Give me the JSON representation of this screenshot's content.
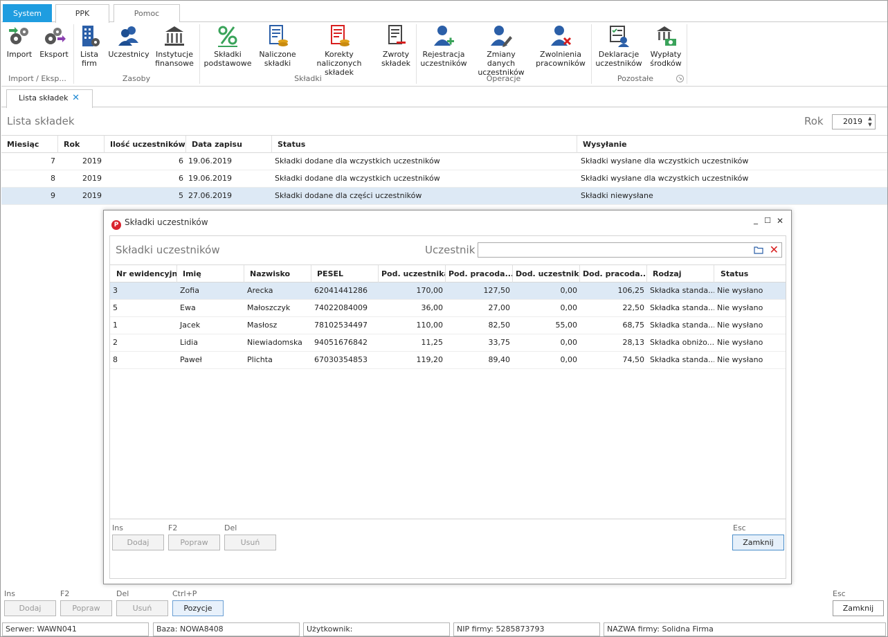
{
  "tabs": {
    "system": "System",
    "ppk": "PPK",
    "pomoc": "Pomoc"
  },
  "ribbon": {
    "buttons": [
      {
        "label": "Import",
        "icon": "gears-import-icon"
      },
      {
        "label": "Eksport",
        "icon": "gears-export-icon"
      },
      {
        "label": "Lista\nfirm",
        "icon": "building-icon"
      },
      {
        "label": "Uczestnicy",
        "icon": "users-icon"
      },
      {
        "label": "Instytucje\nfinansowe",
        "icon": "bank-icon"
      },
      {
        "label": "Składki\npodstawowe",
        "icon": "percent-icon"
      },
      {
        "label": "Naliczone\nskładki",
        "icon": "document-coins-icon"
      },
      {
        "label": "Korekty naliczonych\nskładek",
        "icon": "document-correction-icon"
      },
      {
        "label": "Zwroty\nskładek",
        "icon": "document-return-icon"
      },
      {
        "label": "Rejestracja\nuczestników",
        "icon": "user-add-icon"
      },
      {
        "label": "Zmiany danych\nuczestników",
        "icon": "user-edit-icon"
      },
      {
        "label": "Zwolnienia\npracowników",
        "icon": "user-remove-icon"
      },
      {
        "label": "Deklaracje\nuczestników",
        "icon": "declaration-icon"
      },
      {
        "label": "Wypłaty\nśrodków",
        "icon": "payout-icon"
      }
    ],
    "groups": {
      "import_export": "Import / Eksp...",
      "zasoby": "Zasoby",
      "skladki": "Składki",
      "operacje": "Operacje",
      "pozostale": "Pozostałe"
    }
  },
  "doc_tab": {
    "label": "Lista składek",
    "close": "✕"
  },
  "list": {
    "title": "Lista składek",
    "rok_label": "Rok",
    "rok_value": "2019",
    "columns": [
      "Miesiąc",
      "Rok",
      "Ilość uczestników",
      "Data zapisu",
      "Status",
      "Wysyłanie"
    ],
    "rows": [
      {
        "miesiac": "7",
        "rok": "2019",
        "ilosc": "6",
        "data": "19.06.2019",
        "status": "Składki dodane dla wczystkich uczestników",
        "wysylanie": "Składki wysłane dla wczystkich uczestników"
      },
      {
        "miesiac": "8",
        "rok": "2019",
        "ilosc": "6",
        "data": "19.06.2019",
        "status": "Składki dodane dla wczystkich uczestników",
        "wysylanie": "Składki wysłane dla wczystkich uczestników"
      },
      {
        "miesiac": "9",
        "rok": "2019",
        "ilosc": "5",
        "data": "27.06.2019",
        "status": "Składki dodane dla części uczestników",
        "wysylanie": "Składki niewysłane"
      }
    ]
  },
  "modal": {
    "title": "Składki uczestników",
    "logo": "P",
    "controls": {
      "minimize": "_",
      "maximize": "☐",
      "close": "✕"
    },
    "subtitle": "Składki uczestników",
    "uczestnik_label": "Uczestnik",
    "uczestnik_value": "",
    "columns": [
      "Nr ewidencyjny",
      "Imię",
      "Nazwisko",
      "PESEL",
      "Pod. uczestnika",
      "Pod. pracoda...",
      "Dod. uczestnika",
      "Dod. pracoda...",
      "Rodzaj",
      "Status"
    ],
    "rows": [
      {
        "nr": "3",
        "imie": "Zofia",
        "nazwisko": "Arecka",
        "pesel": "62041441286",
        "pod_u": "170,00",
        "pod_p": "127,50",
        "dod_u": "0,00",
        "dod_p": "106,25",
        "rodzaj": "Składka standa...",
        "status": "Nie wysłano"
      },
      {
        "nr": "5",
        "imie": "Ewa",
        "nazwisko": "Małoszczyk",
        "pesel": "74022084009",
        "pod_u": "36,00",
        "pod_p": "27,00",
        "dod_u": "0,00",
        "dod_p": "22,50",
        "rodzaj": "Składka standa...",
        "status": "Nie wysłano"
      },
      {
        "nr": "1",
        "imie": "Jacek",
        "nazwisko": "Masłosz",
        "pesel": "78102534497",
        "pod_u": "110,00",
        "pod_p": "82,50",
        "dod_u": "55,00",
        "dod_p": "68,75",
        "rodzaj": "Składka standa...",
        "status": "Nie wysłano"
      },
      {
        "nr": "2",
        "imie": "Lidia",
        "nazwisko": "Niewiadomska",
        "pesel": "94051676842",
        "pod_u": "11,25",
        "pod_p": "33,75",
        "dod_u": "0,00",
        "dod_p": "28,13",
        "rodzaj": "Składka obniżo...",
        "status": "Nie wysłano"
      },
      {
        "nr": "8",
        "imie": "Paweł",
        "nazwisko": "Plichta",
        "pesel": "67030354853",
        "pod_u": "119,20",
        "pod_p": "89,40",
        "dod_u": "0,00",
        "dod_p": "74,50",
        "rodzaj": "Składka standa...",
        "status": "Nie wysłano"
      }
    ],
    "footer": {
      "ins": "Ins",
      "f2": "F2",
      "del": "Del",
      "esc": "Esc",
      "dodaj": "Dodaj",
      "popraw": "Popraw",
      "usun": "Usuń",
      "zamknij": "Zamknij"
    }
  },
  "footer": {
    "ins": "Ins",
    "f2": "F2",
    "del": "Del",
    "ctrlp": "Ctrl+P",
    "esc": "Esc",
    "dodaj": "Dodaj",
    "popraw": "Popraw",
    "usun": "Usuń",
    "pozycje": "Pozycje",
    "zamknij": "Zamknij"
  },
  "statusbar": {
    "serwer": "Serwer: WAWN041",
    "baza": "Baza: NOWA8408",
    "uzytkownik": "Użytkownik:",
    "nip": "NIP firmy: 5285873793",
    "nazwa": "NAZWA firmy: Solidna Firma"
  },
  "colors": {
    "accent": "#1f9de0",
    "selection": "#dde9f5",
    "icon_blue": "#2b5fa8",
    "icon_red": "#d81e1e",
    "icon_green": "#3aa35a"
  }
}
